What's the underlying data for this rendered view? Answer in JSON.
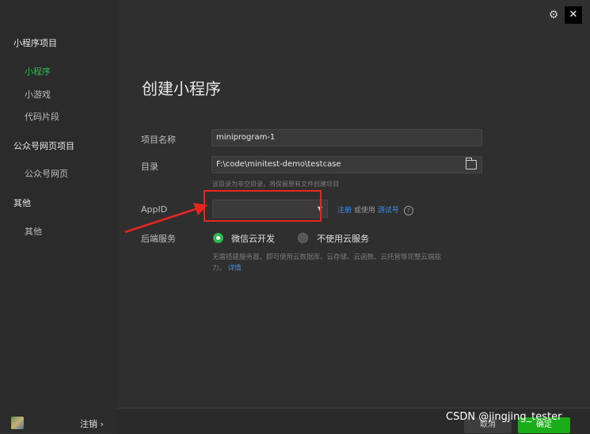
{
  "sidebar": {
    "sections": [
      {
        "label": "小程序项目",
        "items": [
          {
            "label": "小程序",
            "active": true
          },
          {
            "label": "小游戏"
          },
          {
            "label": "代码片段"
          }
        ]
      },
      {
        "label": "公众号网页项目",
        "items": [
          {
            "label": "公众号网页"
          }
        ]
      },
      {
        "label": "其他",
        "items": [
          {
            "label": "其他"
          }
        ]
      }
    ],
    "logout_label": "注销",
    "logout_chevron": "›"
  },
  "topbar": {
    "gear_icon": "⚙",
    "close_icon": "✕"
  },
  "form": {
    "title": "创建小程序",
    "project_name": {
      "label": "项目名称",
      "value": "miniprogram-1"
    },
    "directory": {
      "label": "目录",
      "value": "F:\\code\\minitest-demo\\testcase",
      "hint": "该目录为非空目录，将保留原有文件创建项目"
    },
    "appid": {
      "label": "AppID",
      "value": "",
      "register_link": "注册",
      "or_text": "或使用",
      "test_link": "测试号",
      "help": "?"
    },
    "backend": {
      "label": "后端服务",
      "option_cloud": "微信云开发",
      "option_none": "不使用云服务",
      "hint_line1": "无需搭建服务器，即可使用云数据库、云存储、云函数、云托管等完整云端能",
      "hint_line2": "力。",
      "detail_link": "详情"
    }
  },
  "footer": {
    "cancel_label": "取消",
    "ok_label": "确定",
    "watermark": "CSDN @jingjing_tester"
  },
  "colors": {
    "accent": "#2fb84f",
    "link": "#3d8fe6",
    "annotation": "#e8241e"
  }
}
